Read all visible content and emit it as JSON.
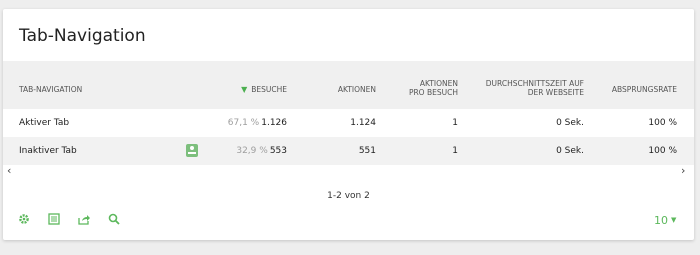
{
  "widget": {
    "title": "Tab-Navigation"
  },
  "columns": {
    "label": "TAB-NAVIGATION",
    "visits": "BESUCHE",
    "actions": "AKTIONEN",
    "actions_per_visit_line1": "AKTIONEN",
    "actions_per_visit_line2": "PRO BESUCH",
    "avg_time_line1": "DURCHSCHNITTSZEIT AUF",
    "avg_time_line2": "DER WEBSEITE",
    "bounce_rate": "ABSPRUNGSRATE"
  },
  "rows": [
    {
      "label": "Aktiver Tab",
      "visits_pct": "67,1 %",
      "visits": "1.126",
      "actions": "1.124",
      "actions_per_visit": "1",
      "avg_time": "0 Sek.",
      "bounce_rate": "100 %"
    },
    {
      "label": "Inaktiver Tab",
      "visits_pct": "32,9 %",
      "visits": "553",
      "actions": "551",
      "actions_per_visit": "1",
      "avg_time": "0 Sek.",
      "bounce_rate": "100 %"
    }
  ],
  "scroll": {
    "left": "‹",
    "right": "›"
  },
  "pagination": {
    "text": "1-2 von 2"
  },
  "footer": {
    "icons": [
      "gear-icon",
      "table-icon",
      "export-icon",
      "search-icon"
    ],
    "limit": "10"
  },
  "colors": {
    "accent": "#5cb85c",
    "header_bg": "#f0f0f0"
  }
}
